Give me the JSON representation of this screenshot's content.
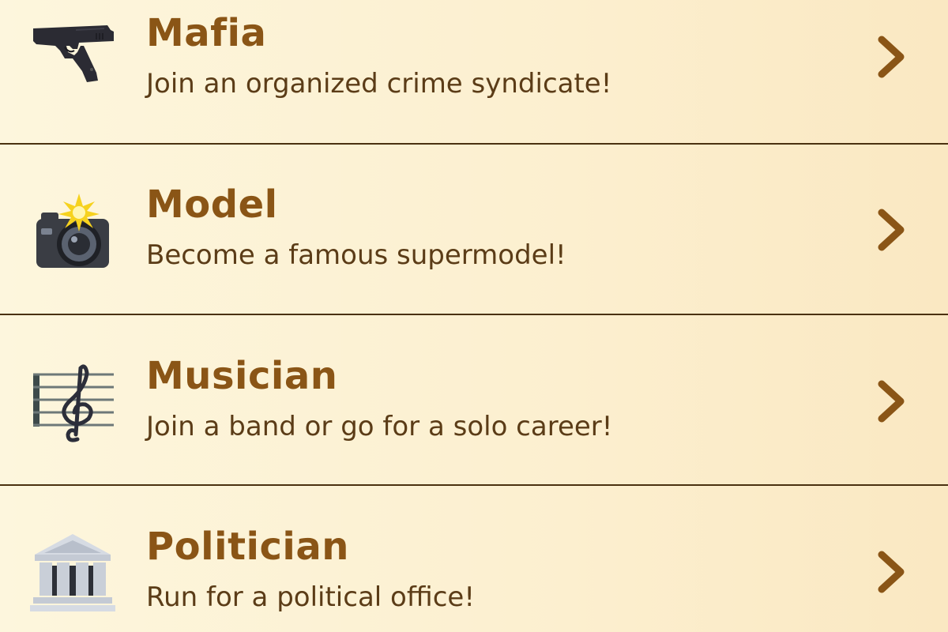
{
  "careers": [
    {
      "title": "Mafia",
      "subtitle": "Join an organized crime syndicate!",
      "icon": "pistol-icon"
    },
    {
      "title": "Model",
      "subtitle": "Become a famous supermodel!",
      "icon": "camera-flash-icon"
    },
    {
      "title": "Musician",
      "subtitle": "Join a band or go for a solo career!",
      "icon": "treble-clef-icon"
    },
    {
      "title": "Politician",
      "subtitle": "Run for a political office!",
      "icon": "government-building-icon"
    }
  ],
  "colors": {
    "title": "#8a5516",
    "subtitle": "#5b3c17",
    "divider": "#4a3110",
    "chevron": "#8a5516",
    "background": "#fdf6dd"
  },
  "chevron_icon": "chevron-right-icon"
}
